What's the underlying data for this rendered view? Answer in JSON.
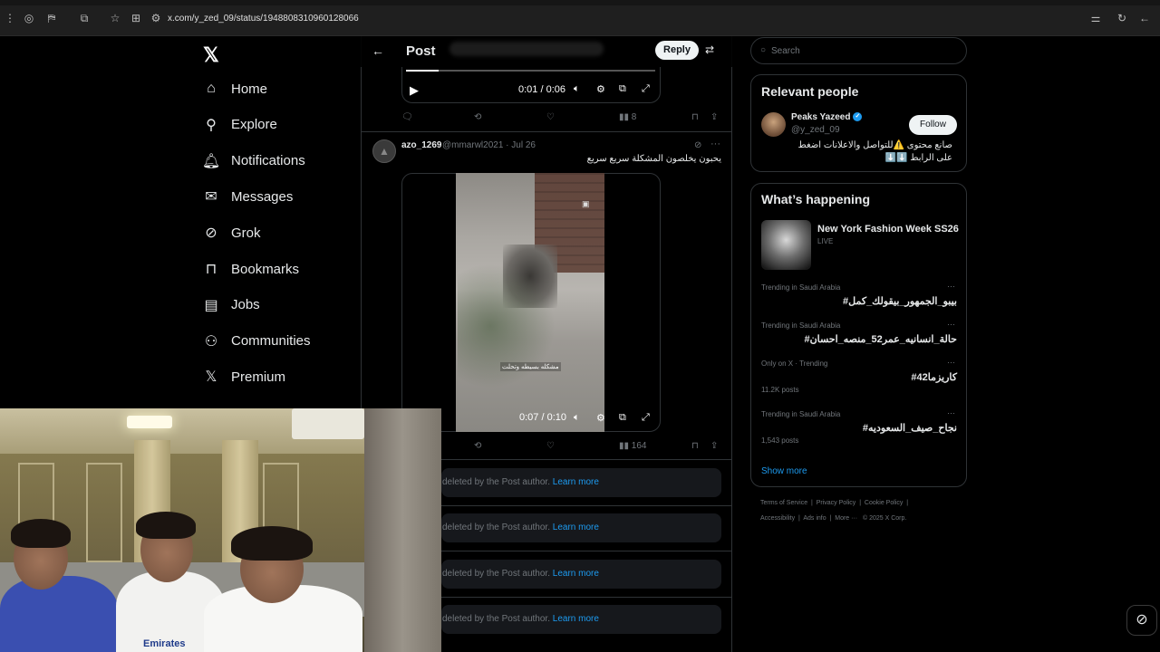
{
  "browser": {
    "url": "x.com/y_zed_09/status/1948808310960128066"
  },
  "nav": {
    "items": [
      {
        "label": "Home",
        "icon": "home-icon"
      },
      {
        "label": "Explore",
        "icon": "search-icon"
      },
      {
        "label": "Notifications",
        "icon": "bell-icon"
      },
      {
        "label": "Messages",
        "icon": "mail-icon"
      },
      {
        "label": "Grok",
        "icon": "grok-icon"
      },
      {
        "label": "Bookmarks",
        "icon": "bookmark-icon"
      },
      {
        "label": "Jobs",
        "icon": "briefcase-icon"
      },
      {
        "label": "Communities",
        "icon": "people-icon"
      },
      {
        "label": "Premium",
        "icon": "x-logo-icon"
      }
    ]
  },
  "header": {
    "title": "Post",
    "reply_label": "Reply"
  },
  "video1": {
    "time": "0:01 / 0:06",
    "progress": 0.13
  },
  "tweet1_actions": {
    "views": "8"
  },
  "tweet2": {
    "name": "azo_1269",
    "handle_date": "@mmarwl2021 · Jul 26",
    "text": "يحبون يخلصون المشكلة سريع سريع",
    "video_caption": "مشكله بسيطه وتحلت",
    "video_time": "0:07 / 0:10",
    "views": "164"
  },
  "deleted": {
    "text": "deleted by the Post author.",
    "link": "Learn more"
  },
  "search": {
    "placeholder": "Search"
  },
  "relevant": {
    "title": "Relevant people",
    "name": "Peaks Yazeed",
    "handle": "@y_zed_09",
    "bio": "صانع محتوى ⚠️للتواصل والاعلانات اضغط على الرابط ⬇️⬇️",
    "follow_label": "Follow"
  },
  "happening": {
    "title": "What’s happening",
    "feature": {
      "title": "New York Fashion Week SS26",
      "status": "LIVE"
    },
    "trends": [
      {
        "context": "Trending in Saudi Arabia",
        "name": "#بيبو_الجمهور_بيقولك_كمل",
        "count": ""
      },
      {
        "context": "Trending in Saudi Arabia",
        "name": "#حالة_انسانيه_عمر52_منصه_احسان",
        "count": ""
      },
      {
        "context": "Only on X · Trending",
        "name": "#كاريزما42",
        "count": "11.2K posts"
      },
      {
        "context": "Trending in Saudi Arabia",
        "name": "#نجاح_صيف_السعوديه",
        "count": "1,543 posts"
      }
    ],
    "show_more": "Show more"
  },
  "footer": {
    "line1": [
      "Terms of Service",
      "Privacy Policy",
      "Cookie Policy"
    ],
    "line2": [
      "Accessibility",
      "Ads info",
      "More ···",
      "© 2025 X Corp."
    ]
  },
  "webcam": {
    "shirt_text": "Emirates"
  }
}
